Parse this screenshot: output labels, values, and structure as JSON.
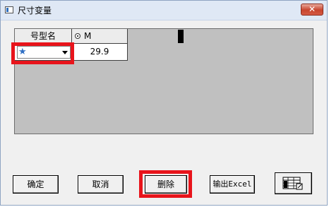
{
  "window": {
    "title": "尺寸变量",
    "close_label": "✕"
  },
  "grid": {
    "columns": [
      {
        "label": "号型名"
      },
      {
        "label": "M",
        "selected": true
      }
    ],
    "rows": [
      {
        "name_value": "",
        "value": "29.9"
      }
    ]
  },
  "buttons": {
    "ok": "确定",
    "cancel": "取消",
    "delete": "删除",
    "export_excel": "输出Excel"
  },
  "icons": {
    "app": "window-app-icon",
    "star": "star-icon",
    "dropdown": "caret-down-icon",
    "sheet": "spreadsheet-icon"
  },
  "colors": {
    "highlight": "#e8141b",
    "grid_background": "#c0c0c0",
    "titlebar": "#dfe8f5"
  }
}
